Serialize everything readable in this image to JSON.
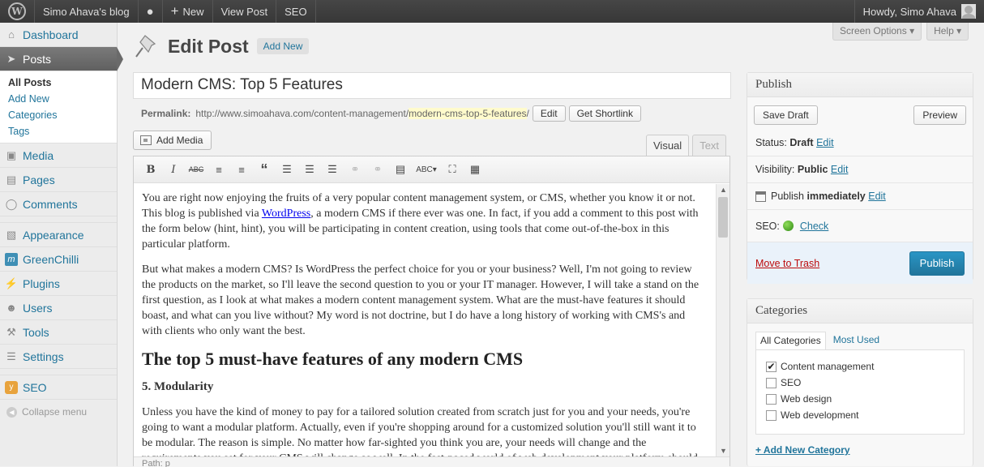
{
  "adminbar": {
    "site_name": "Simo Ahava's blog",
    "new_label": "New",
    "view_post": "View Post",
    "seo": "SEO",
    "howdy": "Howdy, Simo Ahava"
  },
  "sidebar": {
    "items": [
      {
        "label": "Dashboard",
        "icon": "dashboard-icon"
      },
      {
        "label": "Posts",
        "icon": "pin-icon"
      },
      {
        "label": "Media",
        "icon": "media-icon"
      },
      {
        "label": "Pages",
        "icon": "pages-icon"
      },
      {
        "label": "Comments",
        "icon": "comments-icon"
      },
      {
        "label": "Appearance",
        "icon": "appearance-icon"
      },
      {
        "label": "GreenChilli",
        "icon": "greenchilli-icon"
      },
      {
        "label": "Plugins",
        "icon": "plugins-icon"
      },
      {
        "label": "Users",
        "icon": "users-icon"
      },
      {
        "label": "Tools",
        "icon": "tools-icon"
      },
      {
        "label": "Settings",
        "icon": "settings-icon"
      },
      {
        "label": "SEO",
        "icon": "seo-icon"
      }
    ],
    "submenu": [
      "All Posts",
      "Add New",
      "Categories",
      "Tags"
    ],
    "collapse": "Collapse menu"
  },
  "header": {
    "title": "Edit Post",
    "add_new": "Add New",
    "screen_options": "Screen Options",
    "help": "Help"
  },
  "post": {
    "title": "Modern CMS: Top 5 Features",
    "permalink_label": "Permalink:",
    "permalink_base": "http://www.simoahava.com/content-management/",
    "permalink_slug": "modern-cms-top-5-features",
    "permalink_end": "/",
    "edit_btn": "Edit",
    "shortlink_btn": "Get Shortlink"
  },
  "editor": {
    "add_media": "Add Media",
    "tab_visual": "Visual",
    "tab_text": "Text",
    "p1_a": "You are right now enjoying the fruits of a very popular content management system, or CMS, whether you know it or not. This blog is published via ",
    "p1_link": "WordPress",
    "p1_b": ", a modern CMS if there ever was one. In fact, if you add a comment to this post with the form below (hint, hint), you will be participating in content creation, using tools that come out-of-the-box in this particular platform.",
    "p2": "But what makes a modern CMS? Is WordPress the perfect choice for you or your business? Well, I'm not going to review the products on the market, so I'll leave the second question to you or your IT manager. However, I will take a stand on the first question, as I look at what makes a modern content management system. What are the must-have features it should boast, and what can you live without? My word is not doctrine, but I do have a long history of working with CMS's and with clients who only want the best.",
    "h2": "The top 5 must-have features of any modern CMS",
    "h3": "5. Modularity",
    "p3": "Unless you have the kind of money to pay for a tailored solution created from scratch just for you and your needs, you're going to want a modular platform. Actually, even if you're shopping around for a customized solution you'll still want it to be modular. The reason is simple. No matter how far-sighted you think you are, your needs will change and the requirements you set for your CMS will change as well. In the fast-paced world of web development your platform should provide",
    "path": "Path: p"
  },
  "publish": {
    "heading": "Publish",
    "save_draft": "Save Draft",
    "preview": "Preview",
    "status_label": "Status:",
    "status_value": "Draft",
    "visibility_label": "Visibility:",
    "visibility_value": "Public",
    "publish_label": "Publish",
    "publish_value": "immediately",
    "seo_label": "SEO:",
    "seo_check": "Check",
    "edit": "Edit",
    "trash": "Move to Trash",
    "publish_btn": "Publish"
  },
  "categories": {
    "heading": "Categories",
    "tab_all": "All Categories",
    "tab_used": "Most Used",
    "items": [
      {
        "label": "Content management",
        "checked": true
      },
      {
        "label": "SEO",
        "checked": false
      },
      {
        "label": "Web design",
        "checked": false
      },
      {
        "label": "Web development",
        "checked": false
      }
    ],
    "add_new": "+ Add New Category"
  },
  "colors": {
    "link": "#21759b",
    "primary_button": "#21759b",
    "adminbar": "#464646"
  }
}
